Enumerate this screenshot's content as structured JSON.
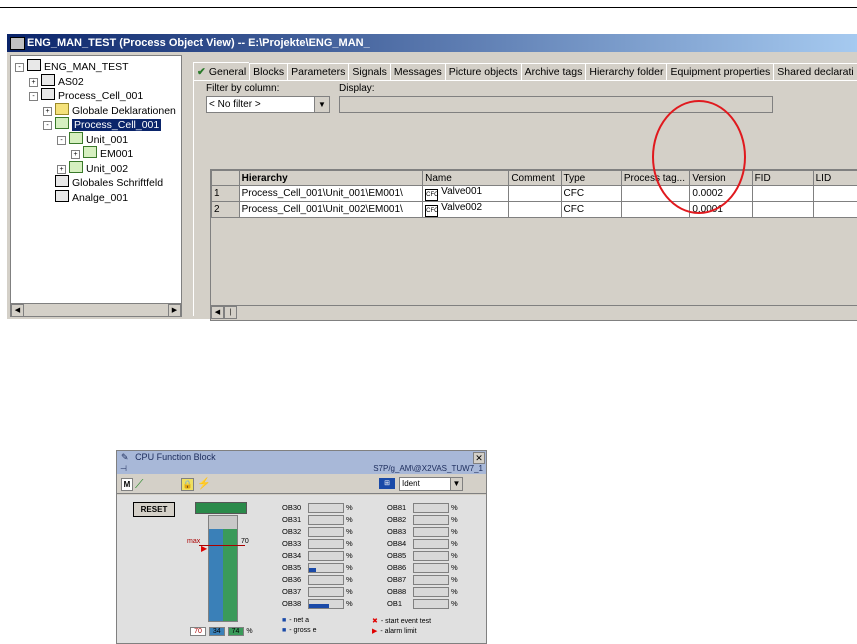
{
  "window1": {
    "title": "ENG_MAN_TEST (Process Object View) -- E:\\Projekte\\ENG_MAN_",
    "tree": [
      {
        "label": "ENG_MAN_TEST",
        "level": 0,
        "expander": "-",
        "icon": "project-icon"
      },
      {
        "label": "AS02",
        "level": 1,
        "expander": "+",
        "icon": "station-icon"
      },
      {
        "label": "Process_Cell_001",
        "level": 1,
        "expander": "-",
        "icon": "station-icon"
      },
      {
        "label": "Globale Deklarationen",
        "level": 2,
        "expander": "+",
        "icon": "folder-icon"
      },
      {
        "label": "Process_Cell_001",
        "level": 2,
        "expander": "-",
        "icon": "unit-icon",
        "selected": true
      },
      {
        "label": "Unit_001",
        "level": 3,
        "expander": "-",
        "icon": "unit-icon"
      },
      {
        "label": "EM001",
        "level": 4,
        "expander": "+",
        "icon": "unit-icon"
      },
      {
        "label": "Unit_002",
        "level": 3,
        "expander": "+",
        "icon": "unit-icon"
      },
      {
        "label": "Globales Schriftfeld",
        "level": 2,
        "expander": "",
        "icon": "document-icon"
      },
      {
        "label": "Analge_001",
        "level": 2,
        "expander": "",
        "icon": "chart-icon"
      }
    ],
    "tabs": [
      "General",
      "Blocks",
      "Parameters",
      "Signals",
      "Messages",
      "Picture objects",
      "Archive tags",
      "Hierarchy folder",
      "Equipment properties",
      "Shared declarati"
    ],
    "filter_label": "Filter by column:",
    "filter_value": "< No filter >",
    "display_label": "Display:",
    "columns": [
      "",
      "Hierarchy",
      "Name",
      "Comment",
      "Type",
      "Process tag...",
      "Version",
      "FID",
      "LID"
    ],
    "rows": [
      {
        "num": "1",
        "hierarchy": "Process_Cell_001\\Unit_001\\EM001\\",
        "name": "Valve001",
        "comment": "",
        "type": "CFC",
        "process_tag": "",
        "version": "0.0002",
        "fid": "",
        "lid": ""
      },
      {
        "num": "2",
        "hierarchy": "Process_Cell_001\\Unit_002\\EM001\\",
        "name": "Valve002",
        "comment": "",
        "type": "CFC",
        "process_tag": "",
        "version": "0.0001",
        "fid": "",
        "lid": ""
      }
    ]
  },
  "window2": {
    "title": "CPU Function Block",
    "subtitle": "S7P/g_AM\\@X2VAS_TUW7_1",
    "dropdown_value": "Ident",
    "toolbar_m": "M",
    "reset_label": "RESET",
    "max_label": "max",
    "max_value": "70",
    "gauge_values": [
      "70",
      "34",
      "74"
    ],
    "gauge_unit": "%",
    "ob_left": [
      {
        "name": "OB30",
        "level": 0
      },
      {
        "name": "OB31",
        "level": 0
      },
      {
        "name": "OB32",
        "level": 0
      },
      {
        "name": "OB33",
        "level": 0
      },
      {
        "name": "OB34",
        "level": 0
      },
      {
        "name": "OB35",
        "level": 0.2
      },
      {
        "name": "OB36",
        "level": 0
      },
      {
        "name": "OB37",
        "level": 0
      },
      {
        "name": "OB38",
        "level": 0.6
      }
    ],
    "ob_right": [
      {
        "name": "OB81",
        "level": 0
      },
      {
        "name": "OB82",
        "level": 0
      },
      {
        "name": "OB83",
        "level": 0
      },
      {
        "name": "OB84",
        "level": 0
      },
      {
        "name": "OB85",
        "level": 0
      },
      {
        "name": "OB86",
        "level": 0
      },
      {
        "name": "OB87",
        "level": 0
      },
      {
        "name": "OB88",
        "level": 0
      },
      {
        "name": "OB1",
        "level": 0
      }
    ],
    "pct_sign": "%",
    "legend": [
      {
        "symbol": "■",
        "text": "- net a"
      },
      {
        "symbol": "■",
        "text": "- gross e"
      },
      {
        "symbol": "✖",
        "text": "- start event test"
      },
      {
        "symbol": "▶",
        "text": "- alarm limit"
      }
    ]
  }
}
